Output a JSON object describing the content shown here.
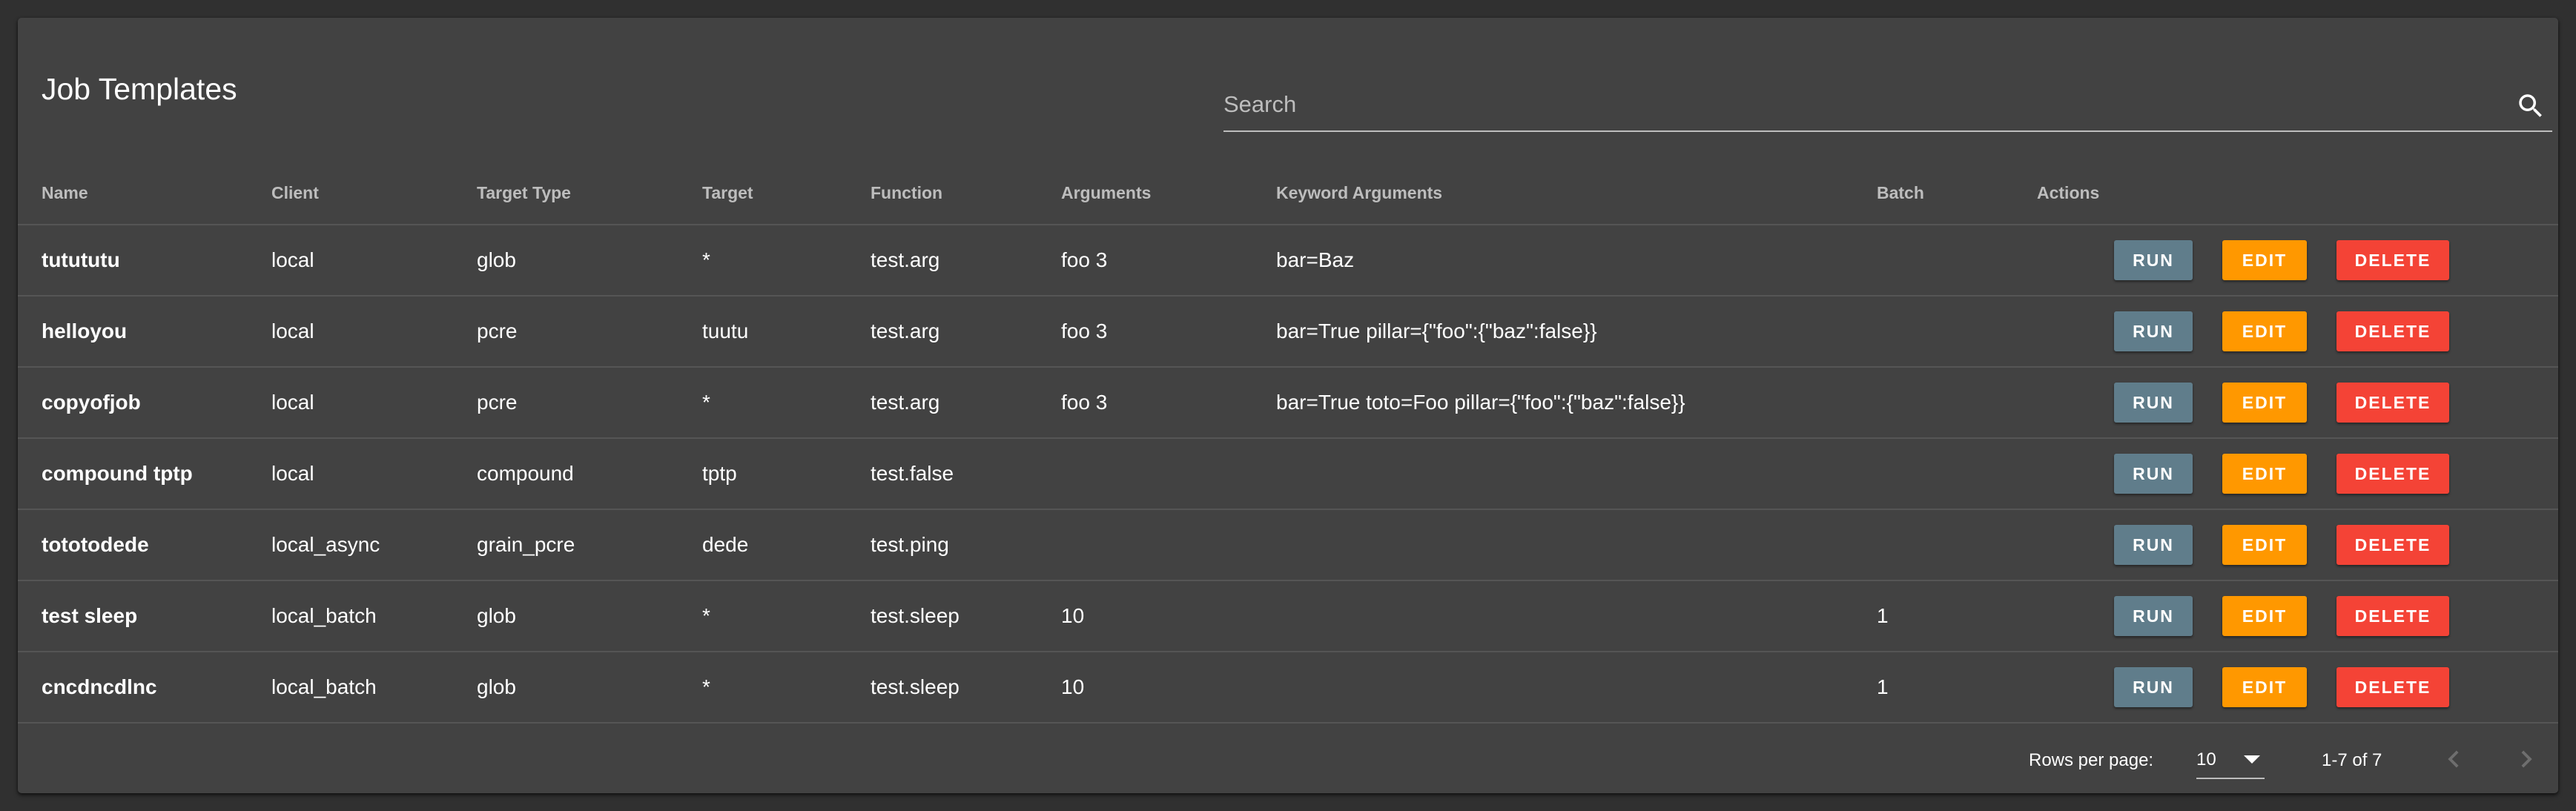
{
  "title": "Job Templates",
  "search": {
    "placeholder": "Search",
    "value": ""
  },
  "columns": [
    "Name",
    "Client",
    "Target Type",
    "Target",
    "Function",
    "Arguments",
    "Keyword Arguments",
    "Batch",
    "Actions"
  ],
  "rows": [
    {
      "name": "tutututu",
      "client": "local",
      "target_type": "glob",
      "target": "*",
      "function": "test.arg",
      "arguments": "foo 3",
      "kwargs": "bar=Baz",
      "batch": ""
    },
    {
      "name": "helloyou",
      "client": "local",
      "target_type": "pcre",
      "target": "tuutu",
      "function": "test.arg",
      "arguments": "foo 3",
      "kwargs": "bar=True pillar={\"foo\":{\"baz\":false}}",
      "batch": ""
    },
    {
      "name": "copyofjob",
      "client": "local",
      "target_type": "pcre",
      "target": "*",
      "function": "test.arg",
      "arguments": "foo 3",
      "kwargs": "bar=True toto=Foo pillar={\"foo\":{\"baz\":false}}",
      "batch": ""
    },
    {
      "name": "compound tptp",
      "client": "local",
      "target_type": "compound",
      "target": "tptp",
      "function": "test.false",
      "arguments": "",
      "kwargs": "",
      "batch": ""
    },
    {
      "name": "tototodede",
      "client": "local_async",
      "target_type": "grain_pcre",
      "target": "dede",
      "function": "test.ping",
      "arguments": "",
      "kwargs": "",
      "batch": ""
    },
    {
      "name": "test sleep",
      "client": "local_batch",
      "target_type": "glob",
      "target": "*",
      "function": "test.sleep",
      "arguments": "10",
      "kwargs": "",
      "batch": "1"
    },
    {
      "name": "cncdncdlnc",
      "client": "local_batch",
      "target_type": "glob",
      "target": "*",
      "function": "test.sleep",
      "arguments": "10",
      "kwargs": "",
      "batch": "1"
    }
  ],
  "actions": {
    "run": "RUN",
    "edit": "EDIT",
    "delete": "DELETE"
  },
  "pagination": {
    "rows_per_page_label": "Rows per page:",
    "rows_per_page": "10",
    "range": "1-7 of 7"
  },
  "colors": {
    "background": "#303030",
    "card": "#424242",
    "run": "#607d8b",
    "edit": "#ff9800",
    "delete": "#f44336"
  },
  "icons": {
    "search": "search-icon",
    "dropdown": "dropdown-arrow-icon",
    "prev": "chevron-left-icon",
    "next": "chevron-right-icon"
  }
}
